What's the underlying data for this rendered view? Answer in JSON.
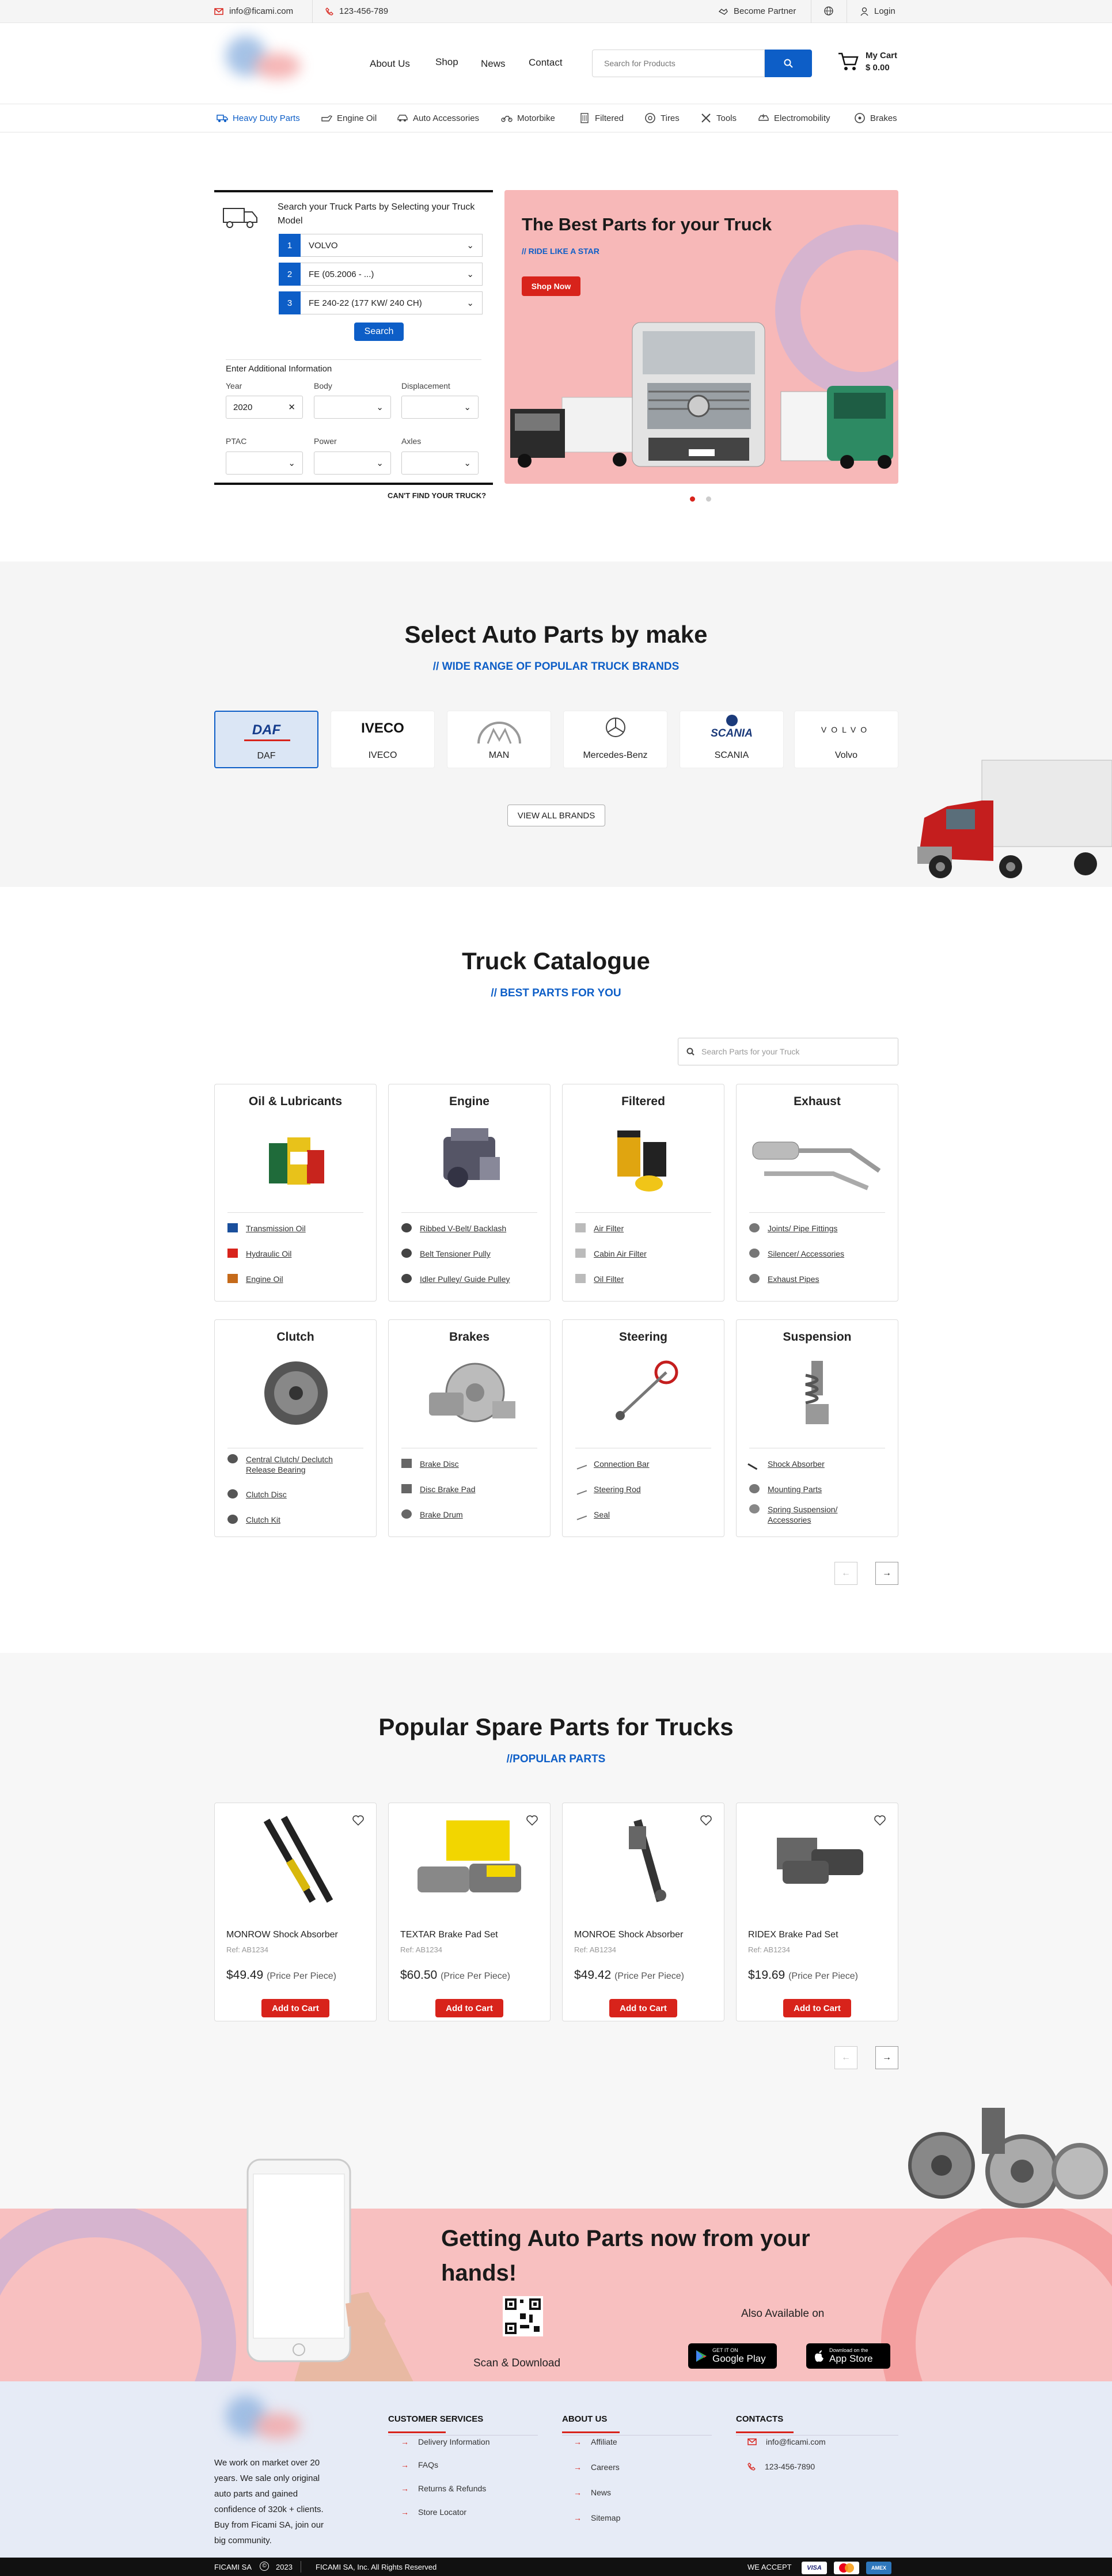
{
  "topbar": {
    "email": "info@ficami.com",
    "phone": "123-456-789",
    "become_partner": "Become Partner",
    "login": "Login"
  },
  "nav": {
    "links": [
      "About Us",
      "Shop",
      "News",
      "Contact"
    ],
    "search_placeholder": "Search for Products",
    "cart_label": "My Cart",
    "cart_total": "$ 0.00"
  },
  "categories": [
    "Heavy Duty Parts",
    "Engine Oil",
    "Auto Accessories",
    "Motorbike",
    "Filtered",
    "Tires",
    "Tools",
    "Electromobility",
    "Brakes"
  ],
  "finder": {
    "title": "Search your Truck Parts by Selecting your Truck Model",
    "steps": [
      {
        "n": "1",
        "value": "VOLVO"
      },
      {
        "n": "2",
        "value": "FE (05.2006 - ...)"
      },
      {
        "n": "3",
        "value": "FE 240-22 (177 KW/ 240 CH)"
      }
    ],
    "search_label": "Search",
    "additional_label": "Enter Additional Information",
    "fields": {
      "year": "Year",
      "year_value": "2020",
      "body": "Body",
      "displacement": "Displacement",
      "ptac": "PTAC",
      "power": "Power",
      "axles": "Axles"
    },
    "cant_find": "CAN'T FIND YOUR TRUCK?"
  },
  "hero": {
    "title": "The Best Parts for your Truck",
    "subtitle": "// RIDE LIKE A STAR",
    "cta": "Shop Now"
  },
  "brands": {
    "title": "Select Auto Parts by make",
    "subtitle": "// WIDE RANGE OF POPULAR TRUCK BRANDS",
    "items": [
      "DAF",
      "IVECO",
      "MAN",
      "Mercedes-Benz",
      "SCANIA",
      "Volvo"
    ],
    "logo_text": [
      "DAF",
      "IVECO",
      "MAN",
      "Mercedes-Benz",
      "SCANIA",
      "VOLVO"
    ],
    "view_all": "VIEW ALL BRANDS"
  },
  "catalogue": {
    "title": "Truck Catalogue",
    "subtitle": "// BEST PARTS FOR YOU",
    "search_placeholder": "Search Parts for your Truck",
    "cards": [
      {
        "title": "Oil & Lubricants",
        "items": [
          "Transmission Oil",
          "Hydraulic Oil",
          "Engine Oil"
        ]
      },
      {
        "title": "Engine",
        "items": [
          "Ribbed V-Belt/ Backlash",
          "Belt Tensioner Pully",
          "Idler Pulley/ Guide Pulley"
        ]
      },
      {
        "title": "Filtered",
        "items": [
          "Air Filter",
          "Cabin Air Filter",
          "Oil Filter"
        ]
      },
      {
        "title": "Exhaust",
        "items": [
          "Joints/ Pipe Fittings",
          "Silencer/ Accessories",
          "Exhaust Pipes"
        ]
      },
      {
        "title": "Clutch",
        "items": [
          "Central Clutch/ Declutch Release Bearing",
          "Clutch Disc",
          "Clutch Kit"
        ]
      },
      {
        "title": "Brakes",
        "items": [
          "Brake Disc",
          "Disc Brake Pad",
          "Brake Drum"
        ]
      },
      {
        "title": "Steering",
        "items": [
          "Connection Bar",
          "Steering Rod",
          "Seal"
        ]
      },
      {
        "title": "Suspension",
        "items": [
          "Shock Absorber",
          "Mounting Parts",
          "Spring Suspension/ Accessories"
        ]
      }
    ]
  },
  "popular": {
    "title": "Popular Spare Parts for Trucks",
    "subtitle": "//POPULAR PARTS",
    "add_label": "Add to Cart",
    "per_piece": "(Price Per Piece)",
    "products": [
      {
        "name": "MONROW Shock Absorber",
        "ref": "Ref: AB1234",
        "price": "$49.49"
      },
      {
        "name": "TEXTAR Brake Pad Set",
        "ref": "Ref: AB1234",
        "price": "$60.50"
      },
      {
        "name": "MONROE Shock Absorber",
        "ref": "Ref: AB1234",
        "price": "$49.42"
      },
      {
        "name": "RIDEX Brake Pad Set",
        "ref": "Ref: AB1234",
        "price": "$19.69"
      }
    ]
  },
  "app": {
    "title": "Getting Auto Parts now from your hands!",
    "scan": "Scan & Download",
    "available": "Also Available on",
    "google_small": "GET IT ON",
    "google_big": "Google Play",
    "apple_small": "Download on the",
    "apple_big": "App Store"
  },
  "footer": {
    "about": "We work on market over 20 years. We sale only original auto parts and gained confidence of 320k + clients. Buy from Ficami SA, join our big community.",
    "customer_title": "CUSTOMER SERVICES",
    "customer_links": [
      "Delivery Information",
      "FAQs",
      "Returns & Refunds",
      "Store Locator"
    ],
    "about_title": "ABOUT US",
    "about_links": [
      "Affiliate",
      "Careers",
      "News",
      "Sitemap"
    ],
    "contacts_title": "CONTACTS",
    "email": "info@ficami.com",
    "phone": "123-456-7890",
    "company": "FICAMI SA",
    "year": "2023",
    "rights": "FICAMI SA, Inc. All Rights Reserved",
    "we_accept": "WE ACCEPT",
    "cards": [
      "VISA",
      "MC",
      "AMEX"
    ]
  },
  "colors": {
    "brand_blue": "#0d5ec7",
    "brand_red": "#d8231b",
    "hero_pink": "#f7b8b8"
  }
}
